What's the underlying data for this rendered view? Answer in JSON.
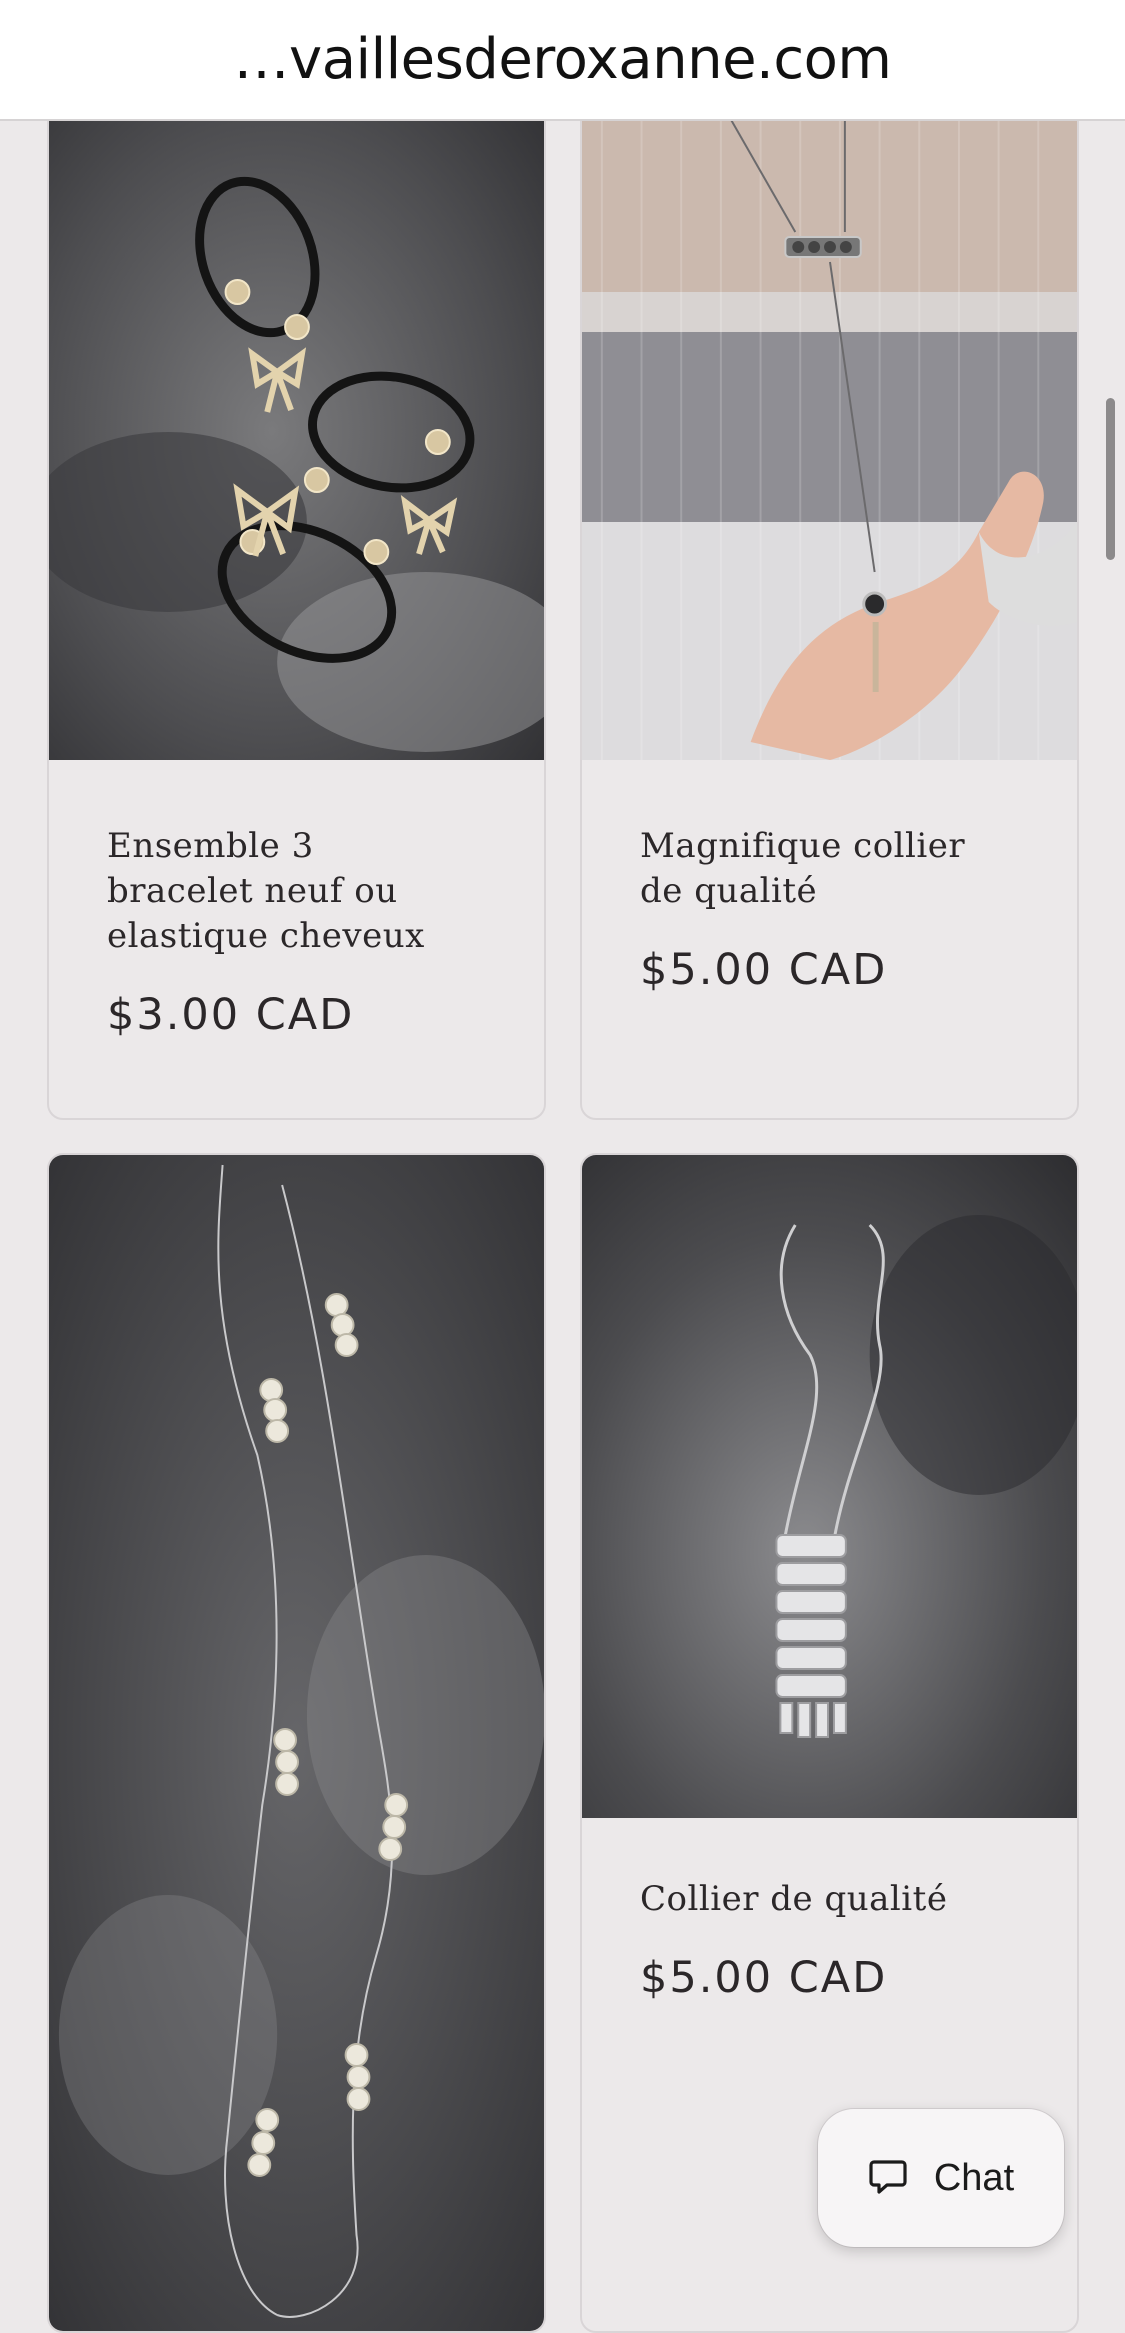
{
  "browser": {
    "url": "…vaillesderoxanne.com"
  },
  "products": [
    {
      "title_lines": [
        "Ensemble 3",
        "bracelet neuf ou",
        "elastique cheveux"
      ],
      "price": "$3.00 CAD",
      "image": "black hair elastics with gold bows on granite"
    },
    {
      "title_lines": [
        "Magnifique collier",
        "de qualité"
      ],
      "price": "$5.00 CAD",
      "image": "long silver bar necklace on striped sweater"
    },
    {
      "title_lines": [],
      "price": "",
      "image": "long pearl station necklace on granite"
    },
    {
      "title_lines": [
        "Collier de qualité"
      ],
      "price": "$5.00 CAD",
      "image": "rhinestone pendant necklace on granite"
    }
  ],
  "chat": {
    "label": "Chat",
    "icon": "chat-bubble-icon"
  },
  "colors": {
    "background": "#ece9ea",
    "text": "#2b2729",
    "granite": "#4a4a4c"
  }
}
